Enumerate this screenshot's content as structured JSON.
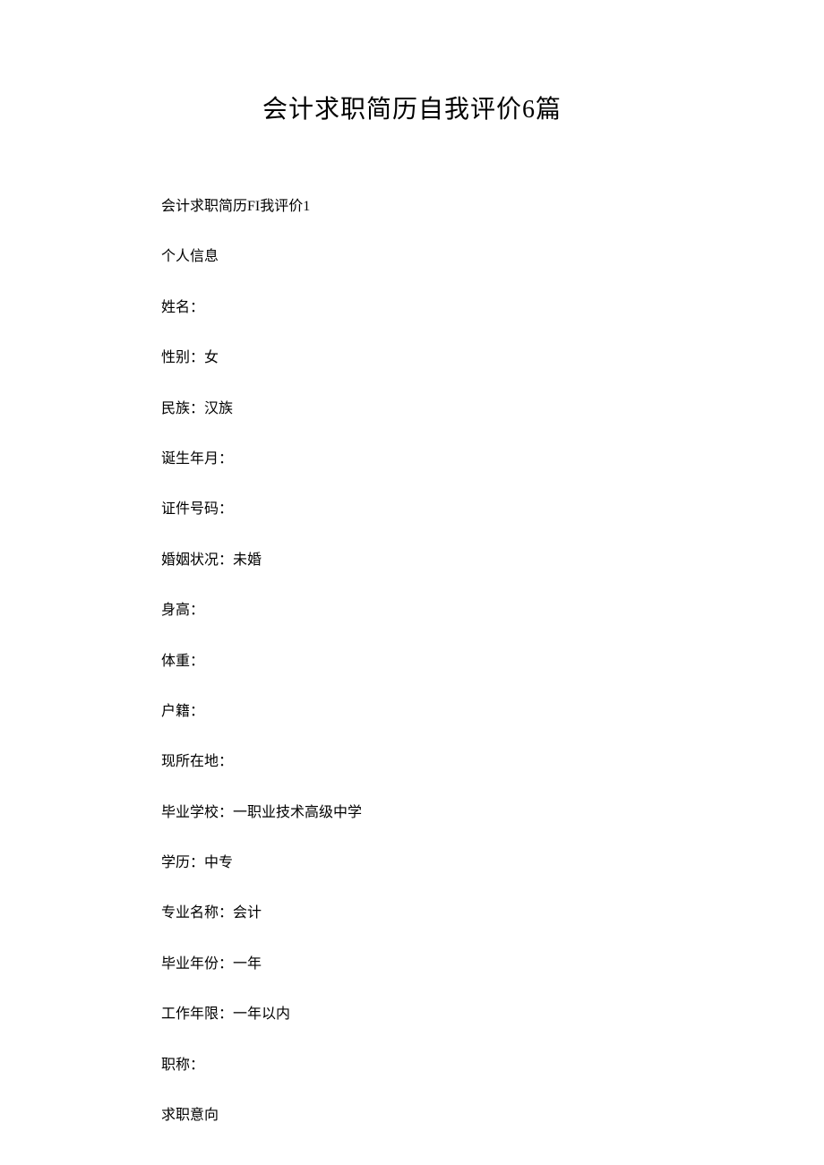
{
  "title": "会计求职简历自我评价6篇",
  "lines": [
    "会计求职简历FI我评价1",
    "个人信息",
    "姓名：",
    "性别：女",
    "民族：汉族",
    "诞生年月：",
    "证件号码：",
    "婚姻状况：未婚",
    "身高：",
    "体重：",
    "户籍：",
    "现所在地：",
    "毕业学校：一职业技术高级中学",
    "学历：中专",
    "专业名称：会计",
    "毕业年份：一年",
    "工作年限：一年以内",
    "职称：",
    "求职意向"
  ]
}
